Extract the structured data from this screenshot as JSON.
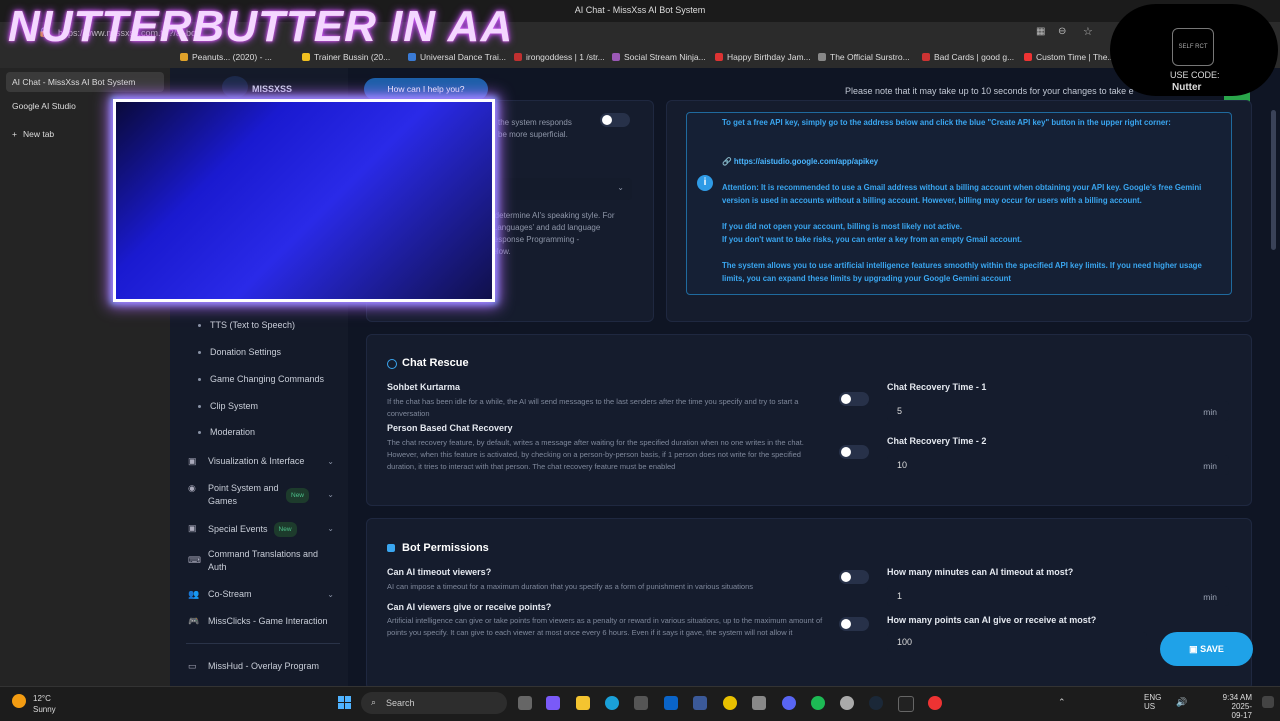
{
  "window": {
    "title": "AI Chat - MissXss AI Bot System"
  },
  "browser": {
    "url": "https://www.missxss.com.tr/?/ai-bot",
    "favorites": [
      {
        "label": "Peanuts... (2020) - ...",
        "color": "#e0a32a"
      },
      {
        "label": "Trainer Bussin (20...",
        "color": "#f0c020"
      },
      {
        "label": "Universal Dance Trai...",
        "color": "#3a7bd5"
      },
      {
        "label": "irongoddess | 1 /str...",
        "color": "#c03030"
      },
      {
        "label": "Social Stream Ninja...",
        "color": "#9b59b6"
      },
      {
        "label": "Happy Birthday Jam...",
        "color": "#d33"
      },
      {
        "label": "The Official Surstro...",
        "color": "#888"
      },
      {
        "label": "Bad Cards | good g...",
        "color": "#c33"
      },
      {
        "label": "Custom Time | The...",
        "color": "#e33"
      }
    ],
    "tabs": [
      "AI Chat - MissXss AI Bot System",
      "Google AI Studio",
      "New tab"
    ]
  },
  "overlay": {
    "stream_title": "NUTTERBUTTER IN AA",
    "badge_line1": "USE CODE:",
    "badge_line2": "Nutter",
    "badge_logo": "SELF RCT"
  },
  "header": {
    "brand": "MISSXSS",
    "pill": "How can I help you?",
    "notice": "Please note that it may take up to 10 seconds for your changes to take e"
  },
  "partial_left": {
    "line1": "the system responds",
    "line2": "be more superficial.",
    "line3": "o determine AI's speaking style. For",
    "line4": "r Languages' and add language",
    "line5": "Response Programming -",
    "line6": "below."
  },
  "info": {
    "p1": "To get a free API key, simply go to the address below and click the blue \"Create API key\" button in the upper right corner:",
    "link": "https://aistudio.google.com/app/apikey",
    "p2": "Attention: It is recommended to use a Gmail address without a billing account when obtaining your API key. Google's free Gemini version is used in accounts without a billing account. However, billing may occur for users with a billing account.",
    "p3": "If you did not open your account, billing is most likely not active.",
    "p4": "If you don't want to take risks, you can enter a key from an empty Gmail account.",
    "p5": "The system allows you to use artificial intelligence features smoothly within the specified API key limits. If you need higher usage limits, you can expand these limits by upgrading your Google Gemini account"
  },
  "sidebar": {
    "sub_items": [
      "TTS (Text to Speech)",
      "Donation Settings",
      "Game Changing Commands",
      "Clip System",
      "Moderation"
    ],
    "items": [
      {
        "label": "Visualization & Interface",
        "icon": "calendar-icon",
        "chev": "⌄"
      },
      {
        "label": "Point System and Games",
        "icon": "coins-icon",
        "badge": "New",
        "chev": "⌄"
      },
      {
        "label": "Special Events",
        "icon": "calendar-icon",
        "badge": "New",
        "chev": "⌄"
      },
      {
        "label": "Command Translations and Auth",
        "icon": "keyboard-icon",
        "chev": ""
      },
      {
        "label": "Co-Stream",
        "icon": "users-icon",
        "chev": "⌄"
      },
      {
        "label": "MissClicks - Game Interaction",
        "icon": "gamepad-icon",
        "chev": ""
      },
      {
        "label": "MissHud - Overlay Program",
        "icon": "monitor-icon",
        "chev": ""
      }
    ]
  },
  "chat_rescue": {
    "title": "Chat Rescue",
    "s1_label": "Sohbet Kurtarma",
    "s1_desc": "If the chat has been idle for a while, the AI will send messages to the last senders after the time you specify and try to start a conversation",
    "s2_label": "Person Based Chat Recovery",
    "s2_desc": "The chat recovery feature, by default, writes a message after waiting for the specified duration when no one writes in the chat. However, when this feature is activated, by checking on a person-by-person basis, if 1 person does not write for the specified duration, it tries to interact with that person. The chat recovery feature must be enabled",
    "f1_label": "Chat Recovery Time - 1",
    "f1_value": "5",
    "f1_unit": "min",
    "f2_label": "Chat Recovery Time - 2",
    "f2_value": "10",
    "f2_unit": "min"
  },
  "bot_permissions": {
    "title": "Bot Permissions",
    "s1_label": "Can AI timeout viewers?",
    "s1_desc": "AI can impose a timeout for a maximum duration that you specify as a form of punishment in various situations",
    "s2_label": "Can AI viewers give or receive points?",
    "s2_desc": "Artificial intelligence can give or take points from viewers as a penalty or reward in various situations, up to the maximum amount of points you specify. It can give to each viewer at most once every 6 hours. Even if it says it gave, the system will not allow it",
    "f1_label": "How many minutes can AI timeout at most?",
    "f1_value": "1",
    "f1_unit": "min",
    "f2_label": "How many points can AI give or receive at most?",
    "f2_value": "100"
  },
  "save_label": "SAVE",
  "taskbar": {
    "weather_temp": "12°C",
    "weather_desc": "Sunny",
    "search": "Search",
    "lang1": "ENG",
    "lang2": "US",
    "time": "9:34 AM",
    "date": "2025-09-17"
  }
}
